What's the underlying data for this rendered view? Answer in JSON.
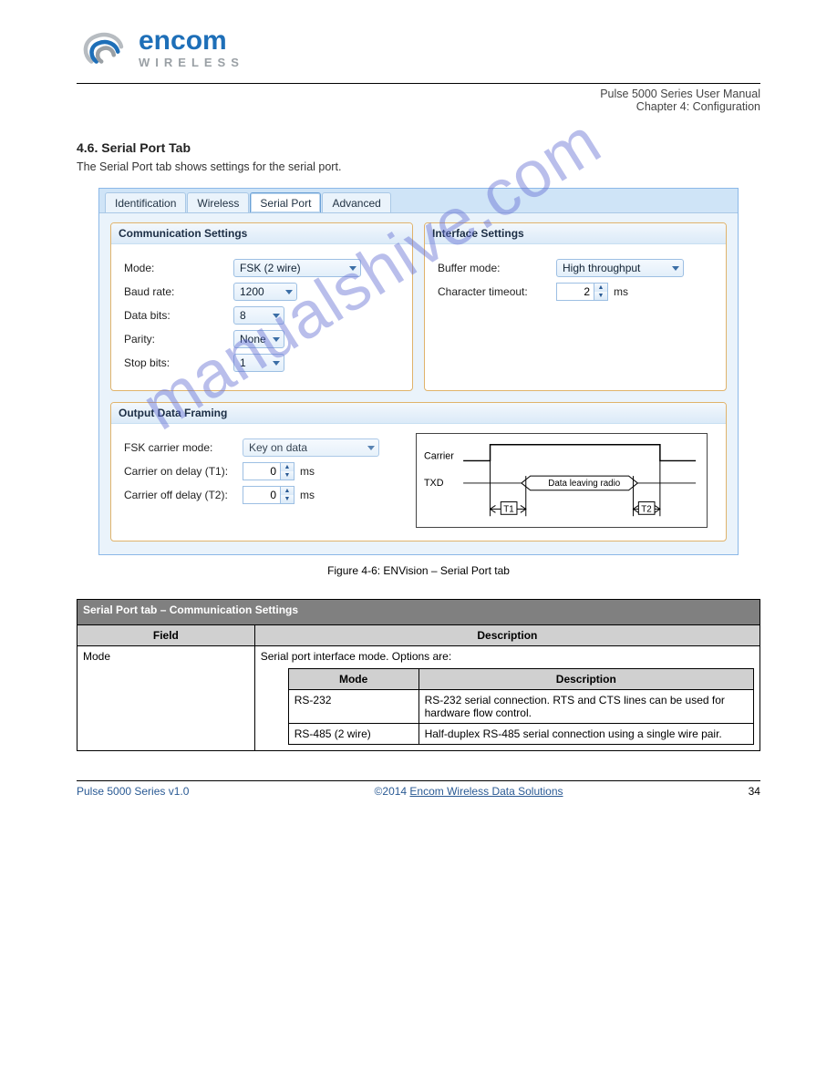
{
  "watermark": "manualshive.com",
  "header": {
    "brand_main": "encom",
    "brand_sub": "WIRELESS",
    "doc_title": "Pulse 5000 Series User Manual",
    "doc_section": "Chapter 4: Configuration"
  },
  "section": {
    "heading": "4.6. Serial Port Tab",
    "subtext": "The Serial Port tab shows settings for the serial port."
  },
  "figure_caption": "Figure 4-6: ENVision – Serial Port tab",
  "app": {
    "tabs": [
      "Identification",
      "Wireless",
      "Serial Port",
      "Advanced"
    ],
    "active_tab_index": 2,
    "panels": {
      "comm": {
        "title": "Communication Settings",
        "fields": {
          "mode_label": "Mode:",
          "mode_value": "FSK (2 wire)",
          "baud_label": "Baud rate:",
          "baud_value": "1200",
          "databits_label": "Data bits:",
          "databits_value": "8",
          "parity_label": "Parity:",
          "parity_value": "None",
          "stopbits_label": "Stop bits:",
          "stopbits_value": "1"
        }
      },
      "iface": {
        "title": "Interface Settings",
        "fields": {
          "buffer_label": "Buffer mode:",
          "buffer_value": "High throughput",
          "ct_label": "Character timeout:",
          "ct_value": "2",
          "ct_unit": "ms"
        }
      },
      "framing": {
        "title": "Output Data Framing",
        "fields": {
          "fsk_label": "FSK carrier mode:",
          "fsk_value": "Key on data",
          "on_label": "Carrier on delay (T1):",
          "on_value": "0",
          "on_unit": "ms",
          "off_label": "Carrier off delay (T2):",
          "off_value": "0",
          "off_unit": "ms"
        },
        "diagram": {
          "carrier_label": "Carrier",
          "txd_label": "TXD",
          "data_label": "Data leaving radio",
          "t1_label": "T1",
          "t2_label": "T2"
        }
      }
    }
  },
  "desc_table": {
    "title": "Serial Port tab – Communication Settings",
    "col_field": "Field",
    "col_desc": "Description",
    "rows": {
      "mode": {
        "field": "Mode",
        "lead": "Serial port interface mode. Options are:",
        "inner": {
          "col_mode": "Mode",
          "col_mdesc": "Description",
          "r1_mode": "RS-232",
          "r1_desc": "RS-232 serial connection. RTS and CTS lines can be used for hardware flow control.",
          "r2_mode": "RS-485 (2 wire)",
          "r2_desc": "Half-duplex RS-485 serial connection using a single wire pair."
        }
      }
    }
  },
  "footer": {
    "left": "Pulse 5000 Series v1.0",
    "mid_prefix": "©2014 ",
    "mid_link": "Encom Wireless Data Solutions",
    "right": "34"
  }
}
